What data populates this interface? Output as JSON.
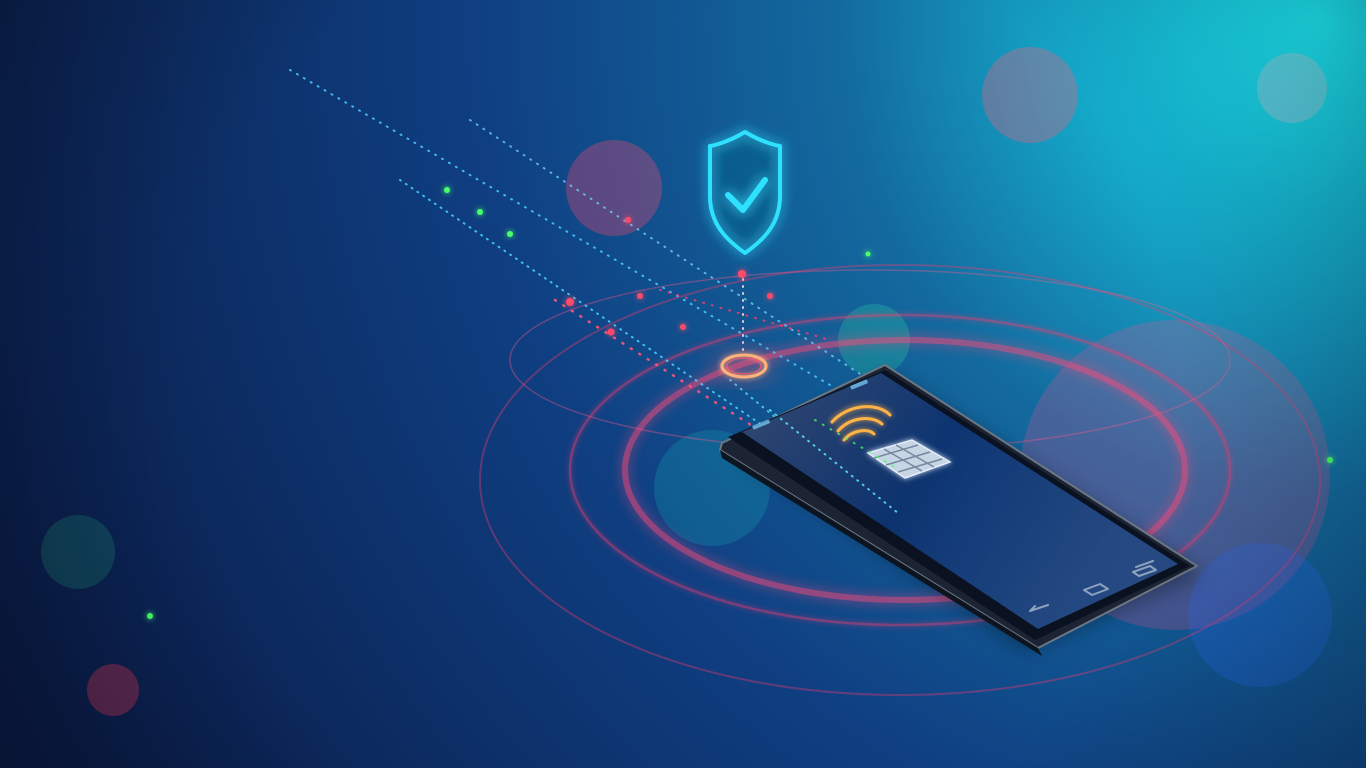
{
  "scene": {
    "subject": "smartphone-with-nfc-chip",
    "icons": [
      "shield-check-icon",
      "nfc-wave-icon",
      "chip-icon",
      "back-icon",
      "home-icon",
      "recents-icon"
    ]
  },
  "colors": {
    "background_deep": "#0a1a40",
    "background_mid": "#123a78",
    "accent_cyan": "#22e0ff",
    "accent_red": "#ff3a5e",
    "accent_orange": "#ffb347",
    "accent_green": "#49ff6a",
    "phone_body": "#111827",
    "phone_screen": "#0c2a62"
  }
}
